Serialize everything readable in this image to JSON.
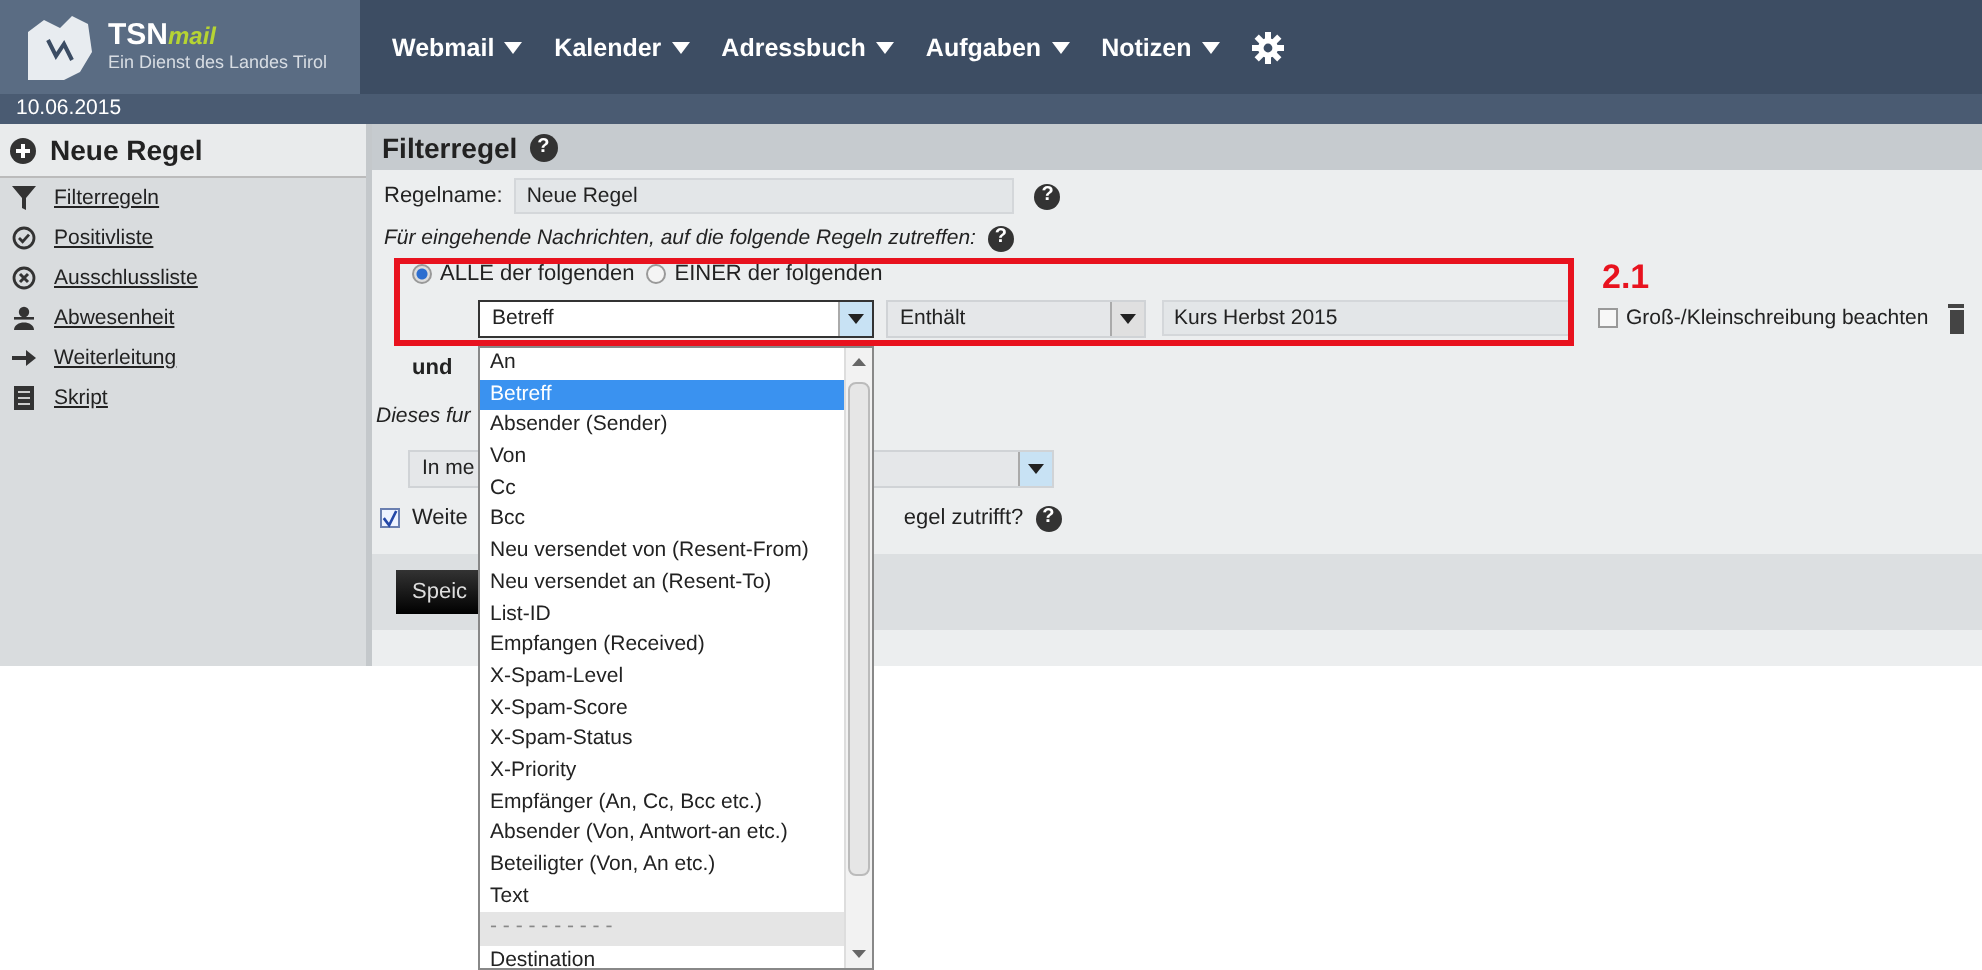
{
  "header": {
    "logo_title": "TSN",
    "logo_suffix": "mail",
    "logo_subtitle": "Ein Dienst des Landes Tirol",
    "nav": [
      "Webmail",
      "Kalender",
      "Adressbuch",
      "Aufgaben",
      "Notizen"
    ]
  },
  "date": "10.06.2015",
  "sidebar": {
    "title": "Neue Regel",
    "items": [
      {
        "label": "Filterregeln"
      },
      {
        "label": "Positivliste"
      },
      {
        "label": "Ausschlussliste"
      },
      {
        "label": "Abwesenheit"
      },
      {
        "label": "Weiterleitung"
      },
      {
        "label": "Skript"
      }
    ]
  },
  "help_icon": "?",
  "panel": {
    "title": "Filterregel",
    "name_label": "Regelname:",
    "name_value": "Neue Regel",
    "intro": "Für eingehende Nachrichten, auf die folgende Regeln zutreffen:",
    "match": [
      {
        "label": "ALLE der folgenden",
        "selected": true
      },
      {
        "label": "EINER der folgenden",
        "selected": false
      }
    ],
    "condition": {
      "field": "Betreff",
      "operator": "Enthält",
      "value": "Kurs Herbst 2015",
      "case_label": "Groß-/Kleinschreibung beachten",
      "case_checked": false
    },
    "and_label": "und",
    "action_intro": "Dieses fur",
    "action_select": "In me",
    "continue_left": "Weite",
    "continue_right": "egel zutrifft?",
    "continue_checked": true,
    "save": "Speic"
  },
  "dropdown": {
    "items": [
      {
        "label": "An",
        "selected": false,
        "kind": "option"
      },
      {
        "label": "Betreff",
        "selected": true,
        "kind": "option"
      },
      {
        "label": "Absender (Sender)",
        "selected": false,
        "kind": "option"
      },
      {
        "label": "Von",
        "selected": false,
        "kind": "option"
      },
      {
        "label": "Cc",
        "selected": false,
        "kind": "option"
      },
      {
        "label": "Bcc",
        "selected": false,
        "kind": "option"
      },
      {
        "label": "Neu versendet von (Resent-From)",
        "selected": false,
        "kind": "option"
      },
      {
        "label": "Neu versendet an (Resent-To)",
        "selected": false,
        "kind": "option"
      },
      {
        "label": "List-ID",
        "selected": false,
        "kind": "option"
      },
      {
        "label": "Empfangen (Received)",
        "selected": false,
        "kind": "option"
      },
      {
        "label": "X-Spam-Level",
        "selected": false,
        "kind": "option"
      },
      {
        "label": "X-Spam-Score",
        "selected": false,
        "kind": "option"
      },
      {
        "label": "X-Spam-Status",
        "selected": false,
        "kind": "option"
      },
      {
        "label": "X-Priority",
        "selected": false,
        "kind": "option"
      },
      {
        "label": "Empfänger (An, Cc, Bcc etc.)",
        "selected": false,
        "kind": "option"
      },
      {
        "label": "Absender (Von, Antwort-an etc.)",
        "selected": false,
        "kind": "option"
      },
      {
        "label": "Beteiligter (Von, An etc.)",
        "selected": false,
        "kind": "option"
      },
      {
        "label": "Text",
        "selected": false,
        "kind": "option"
      },
      {
        "label": "- - - - - - - - - -",
        "selected": false,
        "kind": "separator"
      },
      {
        "label": "Destination",
        "selected": false,
        "kind": "option"
      }
    ]
  },
  "annotation": {
    "label": "2.1"
  }
}
